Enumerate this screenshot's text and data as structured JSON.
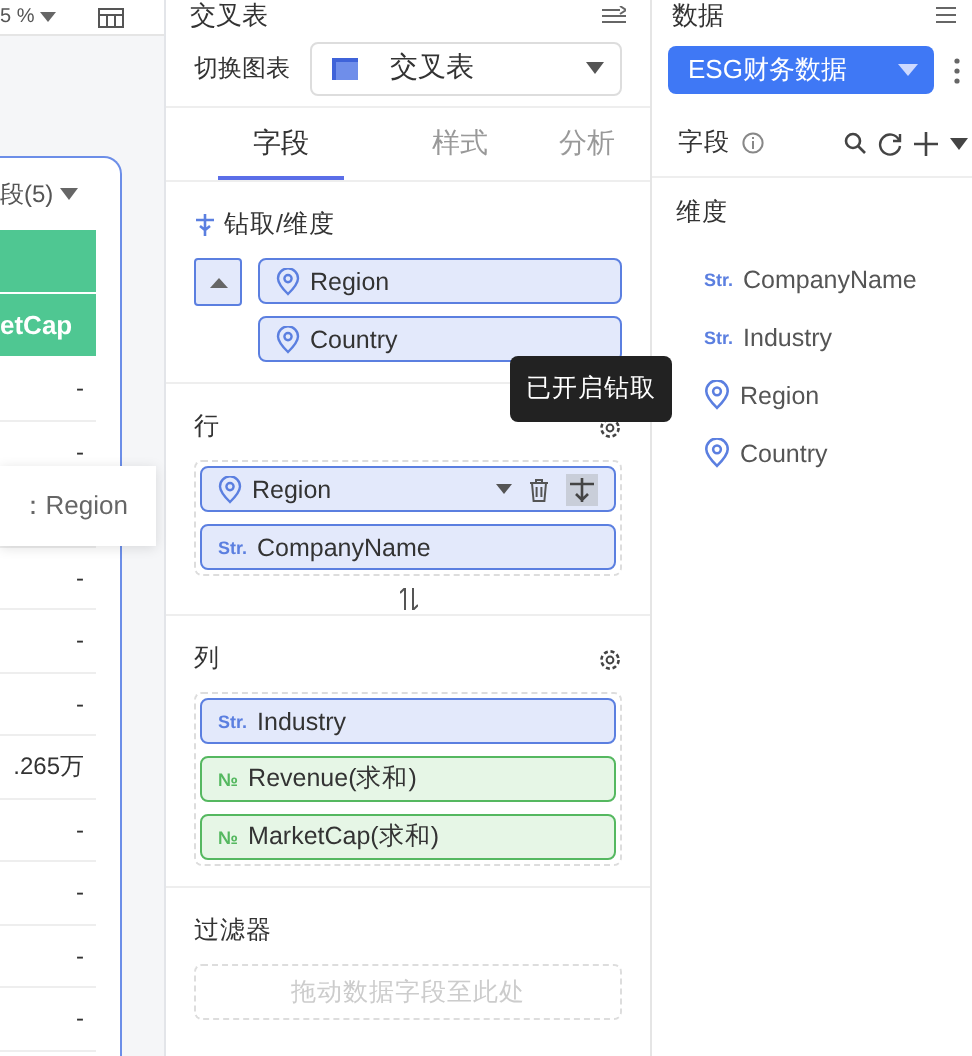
{
  "canvas": {
    "zoom": "5 %",
    "table_header": "段(5)",
    "header_cell": "etCap",
    "rows": [
      {
        "value": "-"
      },
      {
        "value": "-"
      },
      {},
      {
        "value": "-"
      },
      {
        "value": "-"
      },
      {
        "value": "-"
      },
      {
        "value": ".265万"
      },
      {
        "value": "-"
      },
      {
        "value": "-"
      },
      {
        "value": "-"
      },
      {
        "value": "-"
      }
    ],
    "tooltip": "：Region"
  },
  "config": {
    "title": "交叉表",
    "switch_label": "切换图表",
    "chart_type": "交叉表",
    "tabs": [
      {
        "label": "字段",
        "selected": true
      },
      {
        "label": "样式",
        "selected": false
      },
      {
        "label": "分析",
        "selected": false
      }
    ],
    "drill": {
      "title": "钻取/维度",
      "fields": [
        {
          "name": "Region",
          "kind": "geo"
        },
        {
          "name": "Country",
          "kind": "geo"
        }
      ]
    },
    "rows": {
      "title": "行",
      "fields": [
        {
          "name": "Region",
          "kind": "geo",
          "hovered": true
        },
        {
          "name": "CompanyName",
          "kind": "str",
          "type_label": "Str.",
          "hovered": false
        }
      ]
    },
    "columns": {
      "title": "列",
      "fields": [
        {
          "name": "Industry",
          "kind": "str",
          "type_label": "Str.",
          "hovered": false
        },
        {
          "name": "Revenue(求和)",
          "kind": "num",
          "type_label": "№",
          "hovered": false
        },
        {
          "name": "MarketCap(求和)",
          "kind": "num",
          "type_label": "№",
          "hovered": false
        }
      ]
    },
    "filter": {
      "title": "过滤器",
      "placeholder": "拖动数据字段至此处"
    },
    "tooltip": "已开启钻取"
  },
  "data": {
    "title": "数据",
    "dataset": "ESG财务数据",
    "fields_label": "字段",
    "group": "维度",
    "fields": [
      {
        "name": "CompanyName",
        "kind": "str",
        "type_label": "Str."
      },
      {
        "name": "Industry",
        "kind": "str",
        "type_label": "Str."
      },
      {
        "name": "Region",
        "kind": "geo"
      },
      {
        "name": "Country",
        "kind": "geo"
      }
    ]
  }
}
